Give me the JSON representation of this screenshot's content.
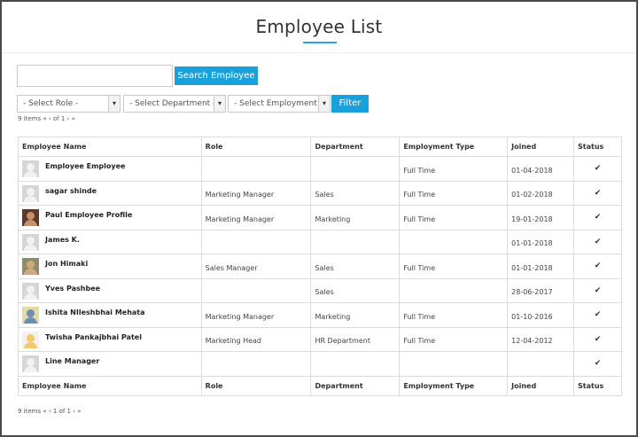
{
  "page": {
    "title": "Employee List"
  },
  "search": {
    "placeholder": "",
    "value": "",
    "button_label": "Search Employee"
  },
  "filters": {
    "role": "- Select Role -",
    "department": "- Select Department -",
    "employment_type": "- Select Employment Ty",
    "button_label": "Filter"
  },
  "pager": {
    "top": "9 items « ‹ of 1 › »",
    "bottom": "9 items « ‹ 1 of 1 › »"
  },
  "table": {
    "columns": [
      "Employee Name",
      "Role",
      "Department",
      "Employment Type",
      "Joined",
      "Status"
    ],
    "rows": [
      {
        "name": "Employee Employee",
        "role": "",
        "department": "",
        "employment_type": "Full Time",
        "joined": "01-04-2018",
        "status": "✔",
        "avatar": "placeholder-avatar"
      },
      {
        "name": "sagar shinde",
        "role": "Marketing Manager",
        "department": "Sales",
        "employment_type": "Full Time",
        "joined": "01-02-2018",
        "status": "✔",
        "avatar": "placeholder-avatar"
      },
      {
        "name": "Paul Employee Profile",
        "role": "Marketing Manager",
        "department": "Marketing",
        "employment_type": "Full Time",
        "joined": "19-01-2018",
        "status": "✔",
        "avatar": "photo-avatar"
      },
      {
        "name": "James K.",
        "role": "",
        "department": "",
        "employment_type": "",
        "joined": "01-01-2018",
        "status": "✔",
        "avatar": "placeholder-avatar"
      },
      {
        "name": "Jon Himaki",
        "role": "Sales Manager",
        "department": "Sales",
        "employment_type": "Full Time",
        "joined": "01-01-2018",
        "status": "✔",
        "avatar": "photo-avatar"
      },
      {
        "name": "Yves Pashbee",
        "role": "",
        "department": "Sales",
        "employment_type": "",
        "joined": "28-06-2017",
        "status": "✔",
        "avatar": "placeholder-avatar"
      },
      {
        "name": "Ishita NIleshbhai Mehata",
        "role": "Marketing Manager",
        "department": "Marketing",
        "employment_type": "Full Time",
        "joined": "01-10-2016",
        "status": "✔",
        "avatar": "photo-avatar"
      },
      {
        "name": "Twisha Pankajbhai Patel",
        "role": "Marketing Head",
        "department": "HR Department",
        "employment_type": "Full Time",
        "joined": "12-04-2012",
        "status": "✔",
        "avatar": "photo-avatar"
      },
      {
        "name": "Line Manager",
        "role": "",
        "department": "",
        "employment_type": "",
        "joined": "",
        "status": "✔",
        "avatar": "placeholder-avatar"
      }
    ]
  },
  "colors": {
    "accent": "#1aa1dc",
    "border": "#dcdcdc"
  }
}
